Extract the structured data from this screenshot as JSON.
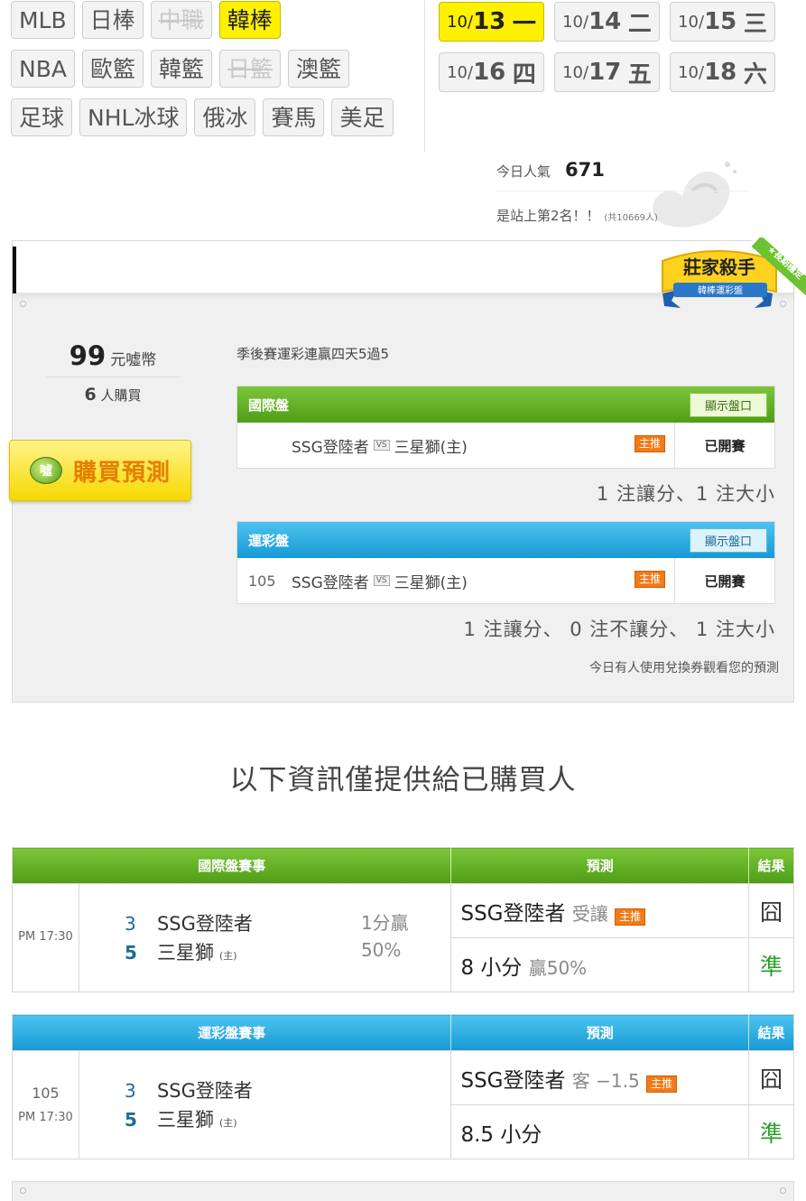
{
  "leagues": {
    "row1": [
      {
        "label": "MLB",
        "state": "normal"
      },
      {
        "label": "日棒",
        "state": "normal"
      },
      {
        "label": "中職",
        "state": "disabled"
      },
      {
        "label": "韓棒",
        "state": "active"
      }
    ],
    "row2": [
      {
        "label": "NBA",
        "state": "normal"
      },
      {
        "label": "歐籃",
        "state": "normal"
      },
      {
        "label": "韓籃",
        "state": "normal"
      },
      {
        "label": "日籃",
        "state": "disabled"
      },
      {
        "label": "澳籃",
        "state": "normal"
      }
    ],
    "row3": [
      {
        "label": "足球",
        "state": "normal"
      },
      {
        "label": "NHL冰球",
        "state": "normal"
      },
      {
        "label": "俄冰",
        "state": "normal"
      },
      {
        "label": "賽馬",
        "state": "normal"
      },
      {
        "label": "美足",
        "state": "normal"
      }
    ]
  },
  "dates": [
    {
      "md": "10/",
      "day": "13",
      "wd": "一",
      "active": true
    },
    {
      "md": "10/",
      "day": "14",
      "wd": "二",
      "active": false
    },
    {
      "md": "10/",
      "day": "15",
      "wd": "三",
      "active": false
    },
    {
      "md": "10/",
      "day": "16",
      "wd": "四",
      "active": false
    },
    {
      "md": "10/",
      "day": "17",
      "wd": "五",
      "active": false
    },
    {
      "md": "10/",
      "day": "18",
      "wd": "六",
      "active": false
    }
  ],
  "popularity": {
    "label": "今日人氣",
    "count": "671",
    "rank_text": "是站上第2名！！",
    "total_text": "(共10669人)"
  },
  "badge": {
    "title": "莊家殺手",
    "subtitle": "韓棒運彩盤",
    "ribbon": "★長期穩定"
  },
  "purchase": {
    "price": "99",
    "price_unit": "元噓幣",
    "buyers_count": "6",
    "buyers_label": "人購買",
    "buy_button": "購買預測",
    "buy_icon_text": "噓"
  },
  "streak_text": "季後賽運彩連贏四天5過5",
  "intl_market": {
    "title": "國際盤",
    "show_button": "顯示盤口",
    "game_no": "",
    "away": "SSG登陸者",
    "vs": "VS",
    "home": "三星獅(主)",
    "tag": "主推",
    "status": "已開賽",
    "summary": "1 注讓分、1 注大小"
  },
  "lottery_market": {
    "title": "運彩盤",
    "show_button": "顯示盤口",
    "game_no": "105",
    "away": "SSG登陸者",
    "vs": "VS",
    "home": "三星獅(主)",
    "tag": "主推",
    "status": "已開賽",
    "summary": "1 注讓分、 0 注不讓分、 1 注大小"
  },
  "voucher_note": "今日有人使用兌換券觀看您的預測",
  "notice": "以下資訊僅提供給已購買人",
  "intl_table": {
    "headers": [
      "國際盤賽事",
      "預測",
      "結果"
    ],
    "time": "PM 17:30",
    "game_no": "",
    "away_score": "3",
    "away_team": "SSG登陸者",
    "home_score": "5",
    "home_team": "三星獅",
    "home_tag": "(主)",
    "result_line1": "1分贏",
    "result_line2": "50%",
    "predictions": [
      {
        "main": "SSG登陸者",
        "sub": "受讓",
        "tag": "主推",
        "result": "囧",
        "result_type": "fail"
      },
      {
        "main": "8 小分",
        "sub": "贏50%",
        "tag": "",
        "result": "準",
        "result_type": "ok"
      }
    ]
  },
  "lottery_table": {
    "headers": [
      "運彩盤賽事",
      "預測",
      "結果"
    ],
    "time": "PM 17:30",
    "game_no": "105",
    "away_score": "3",
    "away_team": "SSG登陸者",
    "home_score": "5",
    "home_team": "三星獅",
    "home_tag": "(主)",
    "predictions": [
      {
        "main": "SSG登陸者",
        "sub": "客 −1.5",
        "tag": "主推",
        "result": "囧",
        "result_type": "fail"
      },
      {
        "main": "8.5 小分",
        "sub": "",
        "tag": "",
        "result": "準",
        "result_type": "ok"
      }
    ]
  },
  "colors": {
    "active_yellow": "#fff100",
    "green_header": "#5ca91f",
    "blue_header": "#22a6dc",
    "tag_orange": "#f07b1a",
    "win_green": "#2aa02a"
  }
}
